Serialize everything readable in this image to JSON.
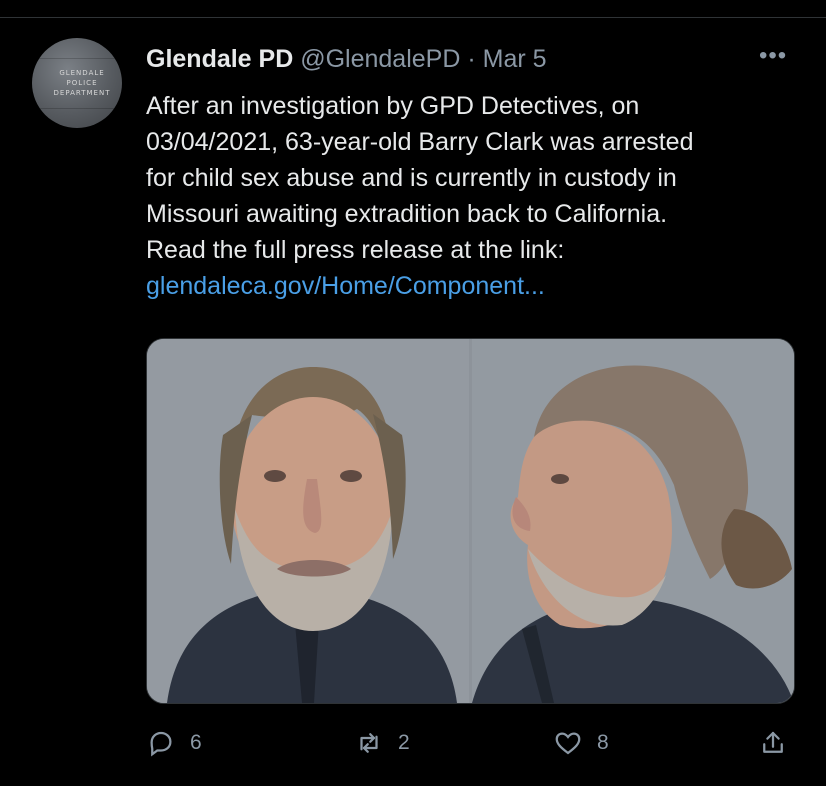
{
  "tweet": {
    "avatar_text": [
      "GLENDALE",
      "POLICE",
      "DEPARTMENT"
    ],
    "name": "Glendale PD",
    "handle": "@GlendalePD",
    "separator": "·",
    "date": "Mar 5",
    "more_label": "•••",
    "text_lines": [
      "After an investigation by GPD Detectives, on",
      "03/04/2021, 63-year-old Barry Clark was arrested",
      "for child sex abuse and is currently in custody in",
      "Missouri awaiting extradition back to California.",
      "Read the full press release at the link:"
    ],
    "link_text": "glendaleca.gov/Home/Component..."
  },
  "actions": {
    "replies": "6",
    "retweets": "2",
    "likes": "8"
  },
  "colors": {
    "background": "#000000",
    "text": "#e7e9ea",
    "muted": "#8b98a5",
    "link": "#4a9fe6",
    "divider": "#2f3336"
  },
  "icons": [
    "reply-icon",
    "retweet-icon",
    "like-icon",
    "share-icon",
    "more-icon"
  ]
}
